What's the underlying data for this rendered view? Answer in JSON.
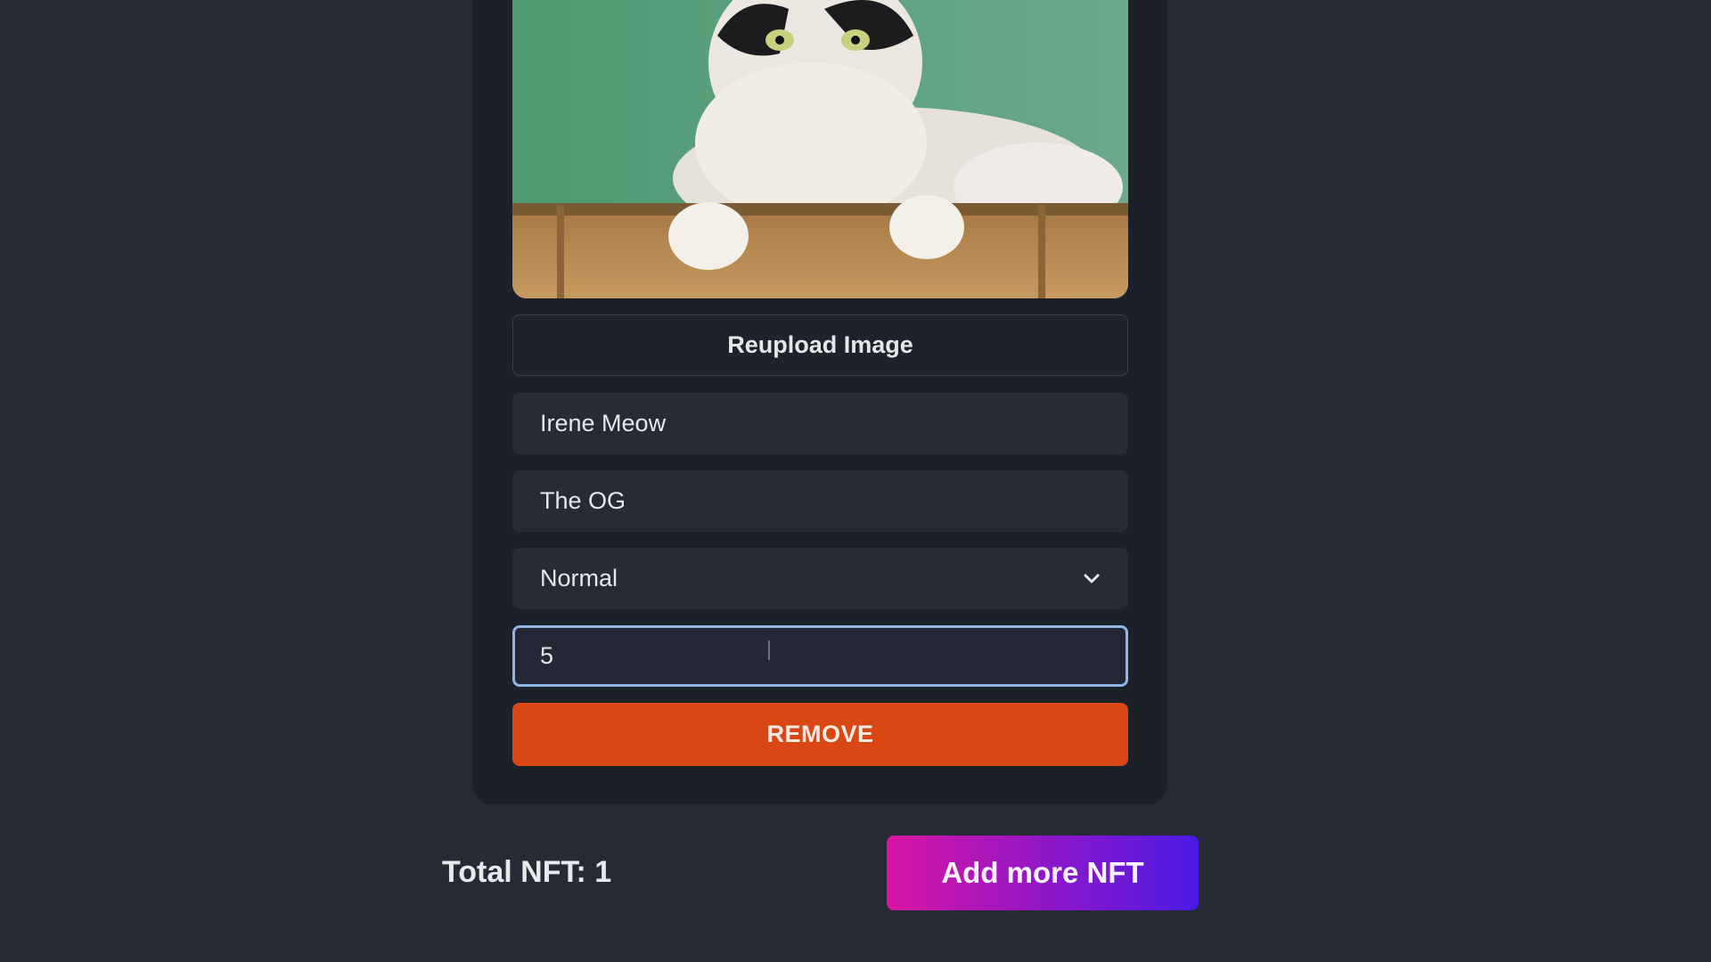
{
  "card": {
    "image_alt": "cat on bamboo",
    "reupload_label": "Reupload Image",
    "name_value": "Irene Meow",
    "description_value": "The OG",
    "rarity_selected": "Normal",
    "quantity_value": "5",
    "remove_label": "REMOVE"
  },
  "footer": {
    "total_label": "Total NFT: 1",
    "add_more_label": "Add more NFT"
  },
  "colors": {
    "page_bg": "#252a35",
    "card_bg": "#1c2029",
    "remove_bg": "#d94714",
    "focus_border": "#8fb7e6",
    "gradient_start": "#d816a3",
    "gradient_end": "#4a1ae6"
  }
}
